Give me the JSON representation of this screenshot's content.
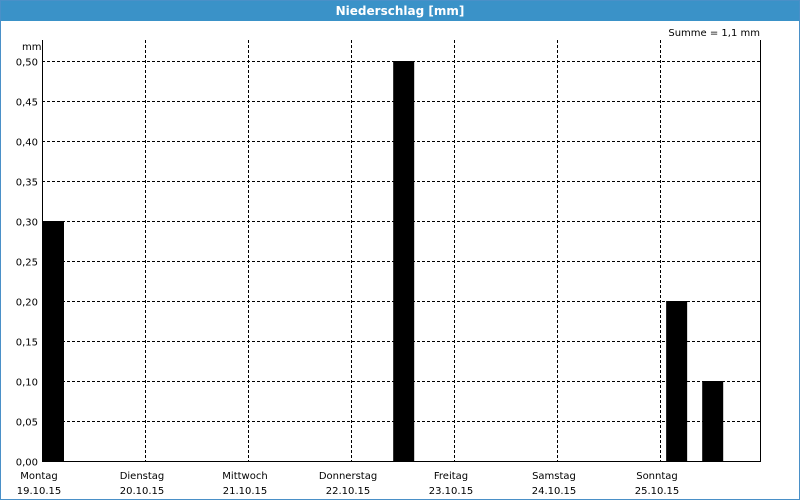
{
  "window": {
    "title": "Niederschlag [mm]"
  },
  "chart_data": {
    "type": "bar",
    "title": "Niederschlag [mm]",
    "ylabel": "mm",
    "annotation": "Summe = 1,1 mm",
    "ylim": [
      0,
      0.5
    ],
    "yticks": [
      "0,00",
      "0,05",
      "0,10",
      "0,15",
      "0,20",
      "0,25",
      "0,30",
      "0,35",
      "0,40",
      "0,45",
      "0,50"
    ],
    "days": [
      {
        "name": "Montag",
        "date": "19.10.15"
      },
      {
        "name": "Dienstag",
        "date": "20.10.15"
      },
      {
        "name": "Mittwoch",
        "date": "21.10.15"
      },
      {
        "name": "Donnerstag",
        "date": "22.10.15"
      },
      {
        "name": "Freitag",
        "date": "23.10.15"
      },
      {
        "name": "Samstag",
        "date": "24.10.15"
      },
      {
        "name": "Sonntag",
        "date": "25.10.15"
      }
    ],
    "series": [
      {
        "points": [
          {
            "day": 0.0,
            "value": 0.3
          },
          {
            "day": 3.4,
            "value": 0.5
          },
          {
            "day": 6.05,
            "value": 0.2
          },
          {
            "day": 6.4,
            "value": 0.1
          }
        ]
      }
    ],
    "grid": true
  }
}
